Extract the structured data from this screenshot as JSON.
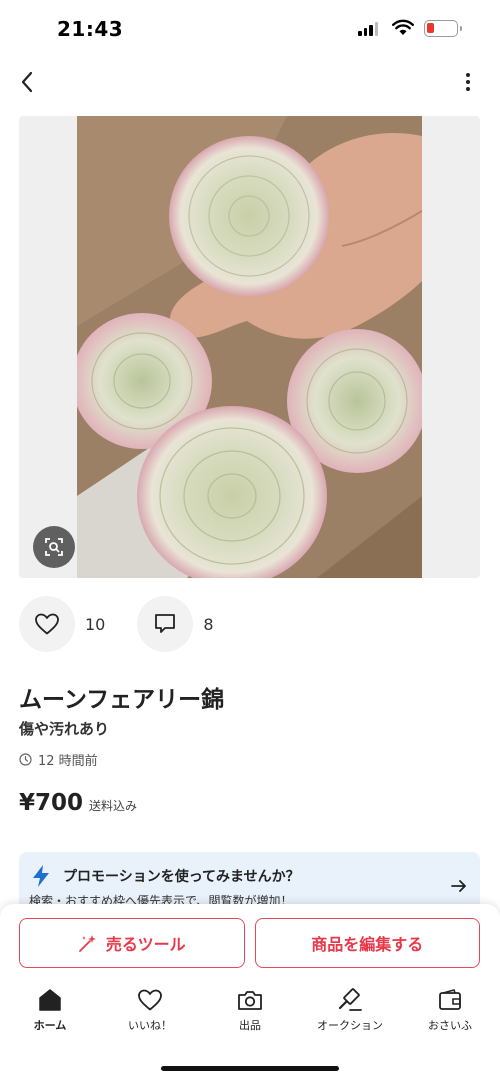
{
  "status_bar": {
    "time": "21:43",
    "battery_color": "#e8382f"
  },
  "nav": {
    "back_icon": "chevron-left-icon",
    "more_icon": "more-vertical-icon"
  },
  "product": {
    "image_alt": "succulent photo",
    "likes": "10",
    "comments": "8",
    "title": "ムーンフェアリー錦",
    "condition": "傷や汚れあり",
    "posted": "12 時間前",
    "price": "¥700",
    "shipping_note": "送料込み"
  },
  "promo": {
    "title": "プロモーションを使ってみませんか？",
    "subtitle": "検索・おすすめ枠へ優先表示で、閲覧数が増加！"
  },
  "actions": {
    "sell_tool": "売るツール",
    "edit_item": "商品を編集する",
    "accent_color": "#e8384a"
  },
  "tabbar": {
    "items": [
      {
        "label": "ホーム",
        "icon": "home-icon"
      },
      {
        "label": "いいね！",
        "icon": "heart-icon"
      },
      {
        "label": "出品",
        "icon": "camera-icon"
      },
      {
        "label": "オークション",
        "icon": "gavel-icon"
      },
      {
        "label": "おさいふ",
        "icon": "wallet-icon"
      }
    ]
  }
}
